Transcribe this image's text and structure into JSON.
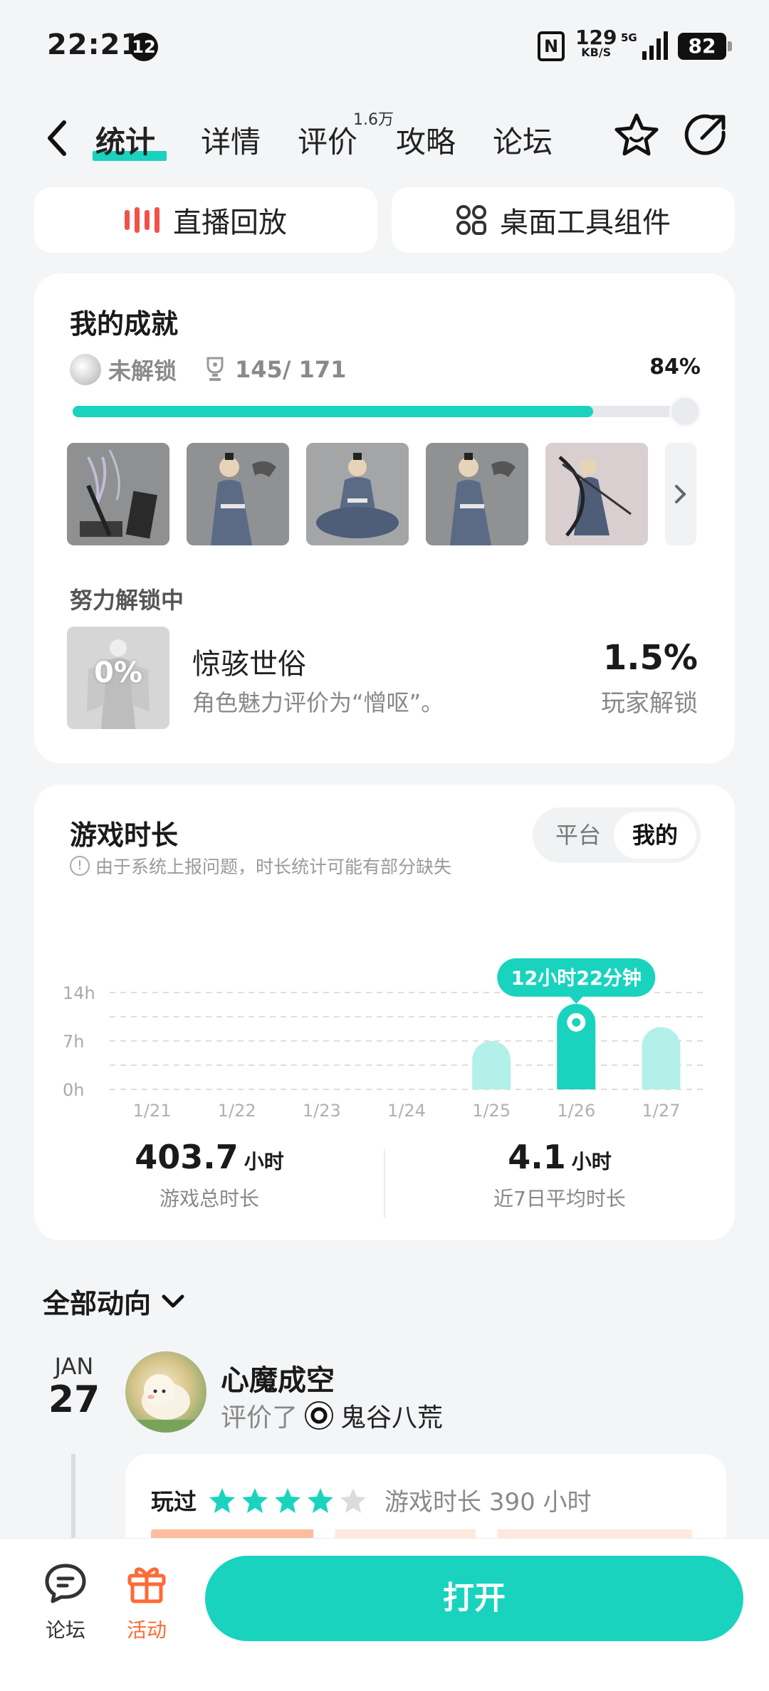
{
  "status_bar": {
    "time": "22:21",
    "notification_count": "12",
    "nfc": "N",
    "net_speed": "129",
    "net_speed_unit": "KB/S",
    "network": "5G",
    "battery": "82"
  },
  "nav": {
    "tabs": [
      {
        "label": "统计",
        "active": true
      },
      {
        "label": "详情",
        "active": false
      },
      {
        "label": "评价",
        "active": false
      },
      {
        "label": "攻略",
        "active": false
      },
      {
        "label": "论坛",
        "active": false
      }
    ],
    "review_count_badge": "1.6万",
    "icons": [
      "back-icon",
      "star-icon",
      "share-icon"
    ]
  },
  "quick_buttons": {
    "replay": "直播回放",
    "widgets": "桌面工具组件"
  },
  "achievements": {
    "title": "我的成就",
    "locked_label": "未解锁",
    "progress_text": "145/ 171",
    "percent_text": "84%",
    "progress": 0.84,
    "in_progress_title": "努力解锁中",
    "item": {
      "badge": "0%",
      "name": "惊骇世俗",
      "desc": "角色魅力评价为“憎呕”。",
      "rate": "1.5%",
      "rate_label": "玩家解锁"
    }
  },
  "playtime": {
    "title": "游戏时长",
    "note": "由于系统上报问题，时长统计可能有部分缺失",
    "segments": {
      "platform": "平台",
      "mine": "我的",
      "selected": "mine"
    },
    "total_value": "403.7",
    "total_unit": "小时",
    "total_label": "游戏总时长",
    "avg_value": "4.1",
    "avg_unit": "小时",
    "avg_label": "近7日平均时长"
  },
  "chart_data": {
    "type": "bar",
    "categories": [
      "1/21",
      "1/22",
      "1/23",
      "1/24",
      "1/25",
      "1/26",
      "1/27"
    ],
    "values": [
      0,
      0,
      0,
      0,
      7,
      12.37,
      9
    ],
    "y_ticks": [
      "0h",
      "7h",
      "14h"
    ],
    "ylim": [
      0,
      14
    ],
    "highlight_index": 5,
    "highlight_label": "12小时22分钟",
    "grid": true,
    "colors": {
      "bar": "#b3f0e9",
      "highlight": "#19d3be",
      "grid": "#dedede"
    }
  },
  "feed": {
    "filter_label": "全部动向",
    "month": "JAN",
    "day": "27",
    "user": "心魔成空",
    "action": "评价了",
    "game": "鬼谷八荒",
    "played_label": "玩过",
    "stars": 4,
    "stars_total": 5,
    "playtime_text": "游戏时长 390 小时"
  },
  "bottom_bar": {
    "forum": "论坛",
    "events": "活动",
    "open": "打开"
  },
  "colors": {
    "accent": "#19d3be",
    "accent_light": "#b3f0e9",
    "orange": "#ff6a35",
    "replay_red": "#f0524a"
  }
}
